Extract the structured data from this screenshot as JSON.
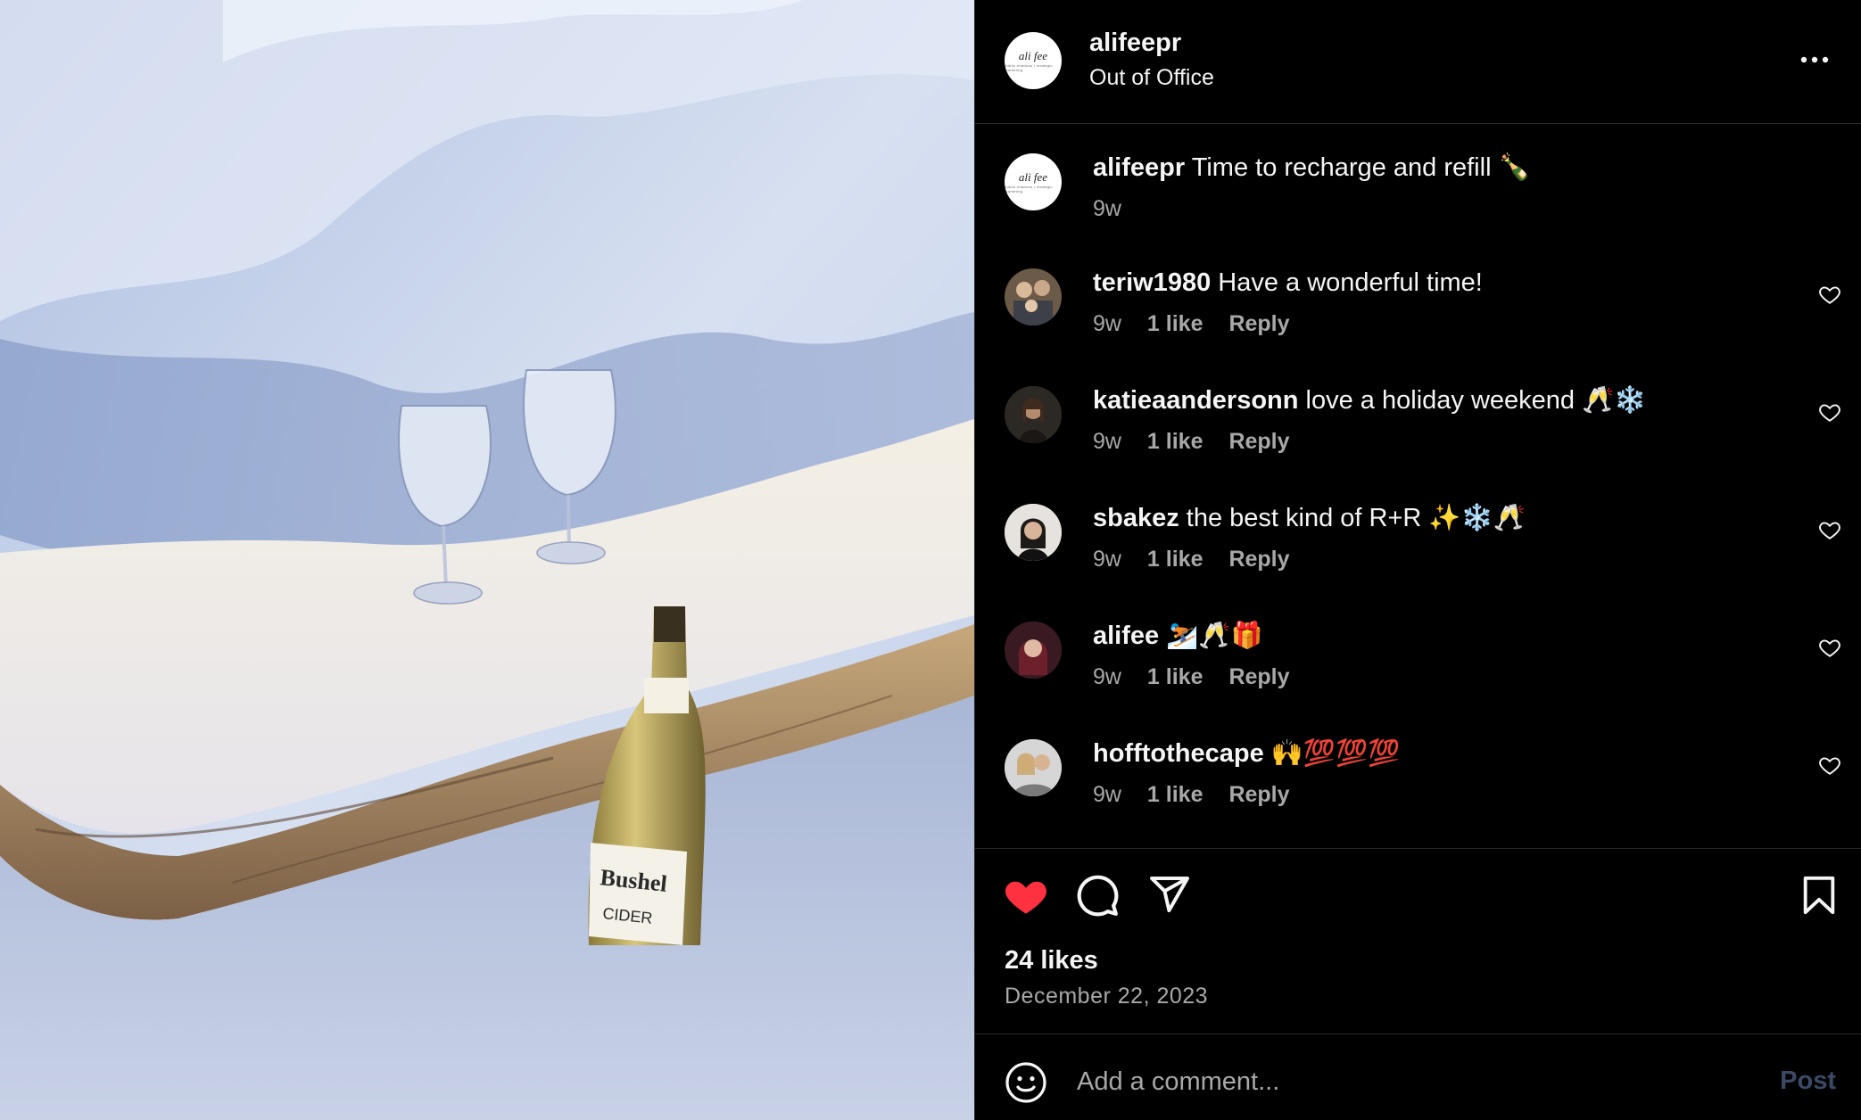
{
  "post": {
    "author": "alifeepr",
    "subtitle": "Out of Office",
    "avatar_logo_text": "ali fee",
    "avatar_logo_tagline": "public relations • strategic marketing",
    "image_label_text": "Bushel",
    "image_label_sub": "CIDER"
  },
  "caption": {
    "username": "alifeepr",
    "text": "Time to recharge and refill 🍾",
    "time": "9w"
  },
  "comments": [
    {
      "username": "teriw1980",
      "text": "Have a wonderful time!",
      "time": "9w",
      "likes": "1 like",
      "reply": "Reply",
      "avatar_color": "#6b5a48"
    },
    {
      "username": "katieaandersonn",
      "text": "love a holiday weekend 🥂❄️",
      "time": "9w",
      "likes": "1 like",
      "reply": "Reply",
      "avatar_color": "#3a2f2a"
    },
    {
      "username": "sbakez",
      "text": "the best kind of R+R ✨❄️🥂",
      "time": "9w",
      "likes": "1 like",
      "reply": "Reply",
      "avatar_color": "#d9d5d0"
    },
    {
      "username": "alifee",
      "text": "⛷️🥂🎁",
      "time": "9w",
      "likes": "1 like",
      "reply": "Reply",
      "avatar_color": "#5a2a35"
    },
    {
      "username": "hofftothecape",
      "text": "🙌💯💯💯",
      "time": "9w",
      "likes": "1 like",
      "reply": "Reply",
      "avatar_color": "#bdbdbd"
    }
  ],
  "engagement": {
    "likes": "24 likes",
    "date": "December 22, 2023",
    "liked": true
  },
  "composer": {
    "placeholder": "Add a comment...",
    "post_label": "Post"
  },
  "colors": {
    "background": "#000000",
    "text_primary": "#f5f5f5",
    "text_secondary": "#a8a8a8",
    "like_red": "#ff3040",
    "divider": "#262626",
    "post_disabled": "#3a4a66"
  },
  "icons": [
    "more-icon",
    "heart-outline-icon",
    "heart-filled-icon",
    "comment-icon",
    "share-icon",
    "bookmark-icon",
    "emoji-icon"
  ]
}
